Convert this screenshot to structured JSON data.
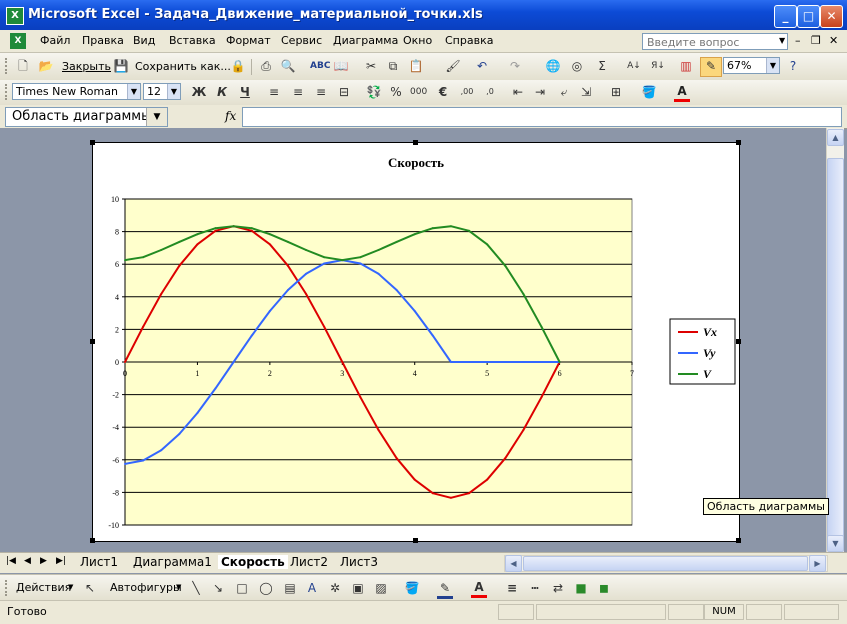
{
  "window": {
    "title": "Microsoft Excel - Задача_Движение_материальной_точки.xls",
    "app_icon": "excel-icon"
  },
  "menu": {
    "items": [
      "Файл",
      "Правка",
      "Вид",
      "Вставка",
      "Формат",
      "Сервис",
      "Диаграмма",
      "Окно",
      "Справка"
    ],
    "help_placeholder": "Введите вопрос"
  },
  "toolbar_standard": {
    "close_label": "Закрыть",
    "save_as_label": "Сохранить как...",
    "zoom": "67%"
  },
  "toolbar_format": {
    "font": "Times New Roman",
    "size": "12",
    "bold": "Ж",
    "italic": "К",
    "underline": "Ч"
  },
  "formula_bar": {
    "name_box": "Область диаграммы",
    "fx": "fx"
  },
  "chart_data": {
    "type": "line",
    "title": "Скорость",
    "xlabel": "",
    "ylabel": "",
    "xlim": [
      0,
      7
    ],
    "ylim": [
      -10,
      10
    ],
    "x_ticks": [
      "0",
      "1",
      "2",
      "3",
      "4",
      "5",
      "6",
      "7"
    ],
    "y_ticks": [
      "10",
      "8",
      "6",
      "4",
      "2",
      "0",
      "-2",
      "-4",
      "-6",
      "-8",
      "-10"
    ],
    "grid": true,
    "legend_position": "right",
    "plot_background": "#ffffcc",
    "x": [
      0,
      0.25,
      0.5,
      0.75,
      1,
      1.25,
      1.5,
      1.75,
      2,
      2.25,
      2.5,
      2.75,
      3,
      3.25,
      3.5,
      3.75,
      4,
      4.25,
      4.5,
      4.75,
      5,
      5.25,
      5.5,
      5.75,
      6
    ],
    "series": [
      {
        "name": "Vx",
        "color": "#dd0000",
        "values": [
          0,
          2.16,
          4.17,
          5.9,
          7.22,
          8.05,
          8.33,
          8.05,
          7.22,
          5.9,
          4.17,
          2.16,
          0,
          -2.16,
          -4.17,
          -5.9,
          -7.22,
          -8.05,
          -8.33,
          -8.05,
          -7.22,
          -5.9,
          -4.17,
          -2.16,
          0
        ]
      },
      {
        "name": "Vy",
        "color": "#3366ff",
        "values": [
          -6.25,
          -6.04,
          -5.41,
          -4.42,
          -3.13,
          -1.62,
          0,
          1.62,
          3.13,
          4.42,
          5.41,
          6.04,
          6.25,
          6.04,
          5.41,
          4.42,
          3.13,
          1.62,
          0,
          0,
          0,
          0,
          0,
          0,
          0
        ]
      },
      {
        "name": "V",
        "color": "#228b22",
        "values": [
          6.25,
          6.43,
          6.87,
          7.37,
          7.84,
          8.21,
          8.33,
          8.21,
          7.84,
          7.37,
          6.87,
          6.43,
          6.25,
          6.43,
          6.87,
          7.37,
          7.84,
          8.21,
          8.33,
          8.05,
          7.22,
          5.9,
          4.17,
          2.16,
          0
        ]
      }
    ]
  },
  "tooltip": "Область диаграммы",
  "sheet_tabs": [
    "Лист1",
    "Диаграмма1",
    "Скорость",
    "Лист2",
    "Лист3"
  ],
  "active_tab": "Скорость",
  "draw_toolbar": {
    "actions_label": "Действия",
    "autoshapes_label": "Автофигуры"
  },
  "status": {
    "ready": "Готово",
    "num": "NUM"
  }
}
